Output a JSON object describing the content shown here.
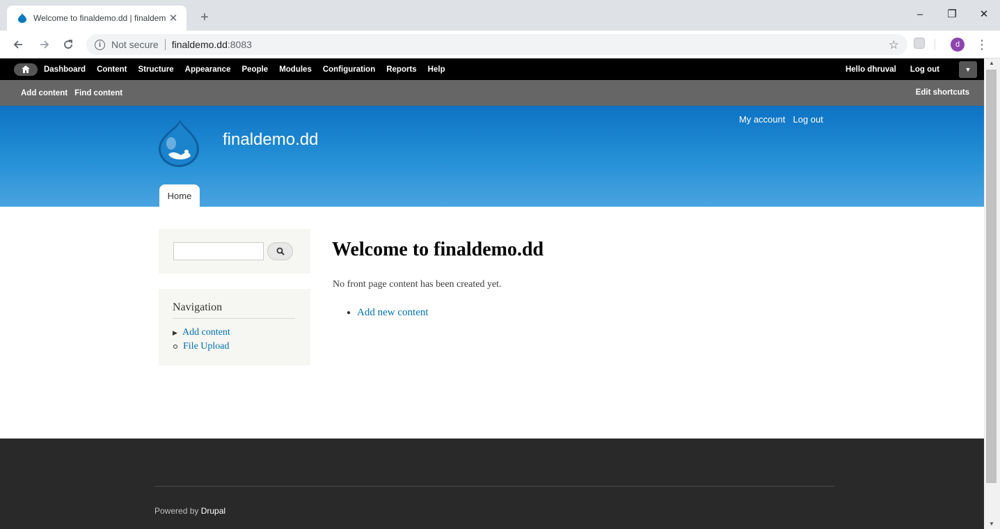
{
  "browser": {
    "tab_title": "Welcome to finaldemo.dd | finaldemo.dd",
    "new_tab": "+",
    "minimize": "–",
    "restore": "❐",
    "close": "✕",
    "security_label": "Not secure",
    "url_host": "finaldemo.dd",
    "url_port": ":8083",
    "avatar_letter": "d"
  },
  "admin_toolbar": {
    "items": [
      "Dashboard",
      "Content",
      "Structure",
      "Appearance",
      "People",
      "Modules",
      "Configuration",
      "Reports",
      "Help"
    ],
    "hello_prefix": "Hello ",
    "username": "dhruval",
    "logout": "Log out"
  },
  "shortcuts": {
    "items": [
      "Add content",
      "Find content"
    ],
    "edit_label": "Edit shortcuts"
  },
  "header": {
    "site_name": "finaldemo.dd",
    "secondary_menu": [
      "My account",
      "Log out"
    ],
    "main_tab": "Home"
  },
  "sidebar": {
    "search_value": "",
    "navigation_title": "Navigation",
    "nav_items": [
      "Add content",
      "File Upload"
    ]
  },
  "main": {
    "title": "Welcome to finaldemo.dd",
    "text": "No front page content has been created yet.",
    "link": "Add new content"
  },
  "footer": {
    "powered_by": "Powered by ",
    "drupal": "Drupal"
  },
  "colors": {
    "header_blue": "#0d72c4",
    "link_blue": "#0071b3",
    "footer_dark": "#292929"
  }
}
